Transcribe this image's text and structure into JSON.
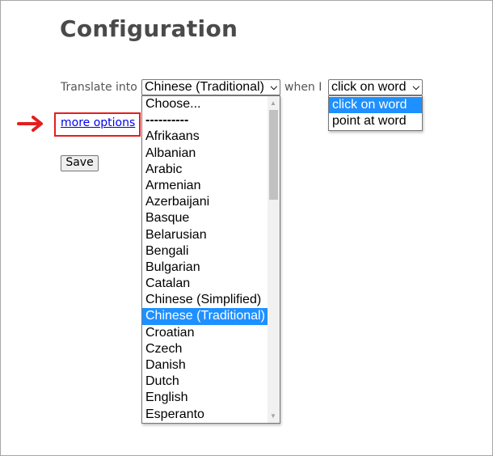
{
  "page": {
    "title": "Configuration",
    "translate_label": "Translate into",
    "when_label": "when I",
    "more_options_link": "more options",
    "save_button": "Save"
  },
  "language_select": {
    "selected": "Chinese (Traditional)",
    "options": [
      {
        "label": "Choose...",
        "selected": false
      },
      {
        "label": "----------",
        "selected": false
      },
      {
        "label": "Afrikaans",
        "selected": false
      },
      {
        "label": "Albanian",
        "selected": false
      },
      {
        "label": "Arabic",
        "selected": false
      },
      {
        "label": "Armenian",
        "selected": false
      },
      {
        "label": "Azerbaijani",
        "selected": false
      },
      {
        "label": "Basque",
        "selected": false
      },
      {
        "label": "Belarusian",
        "selected": false
      },
      {
        "label": "Bengali",
        "selected": false
      },
      {
        "label": "Bulgarian",
        "selected": false
      },
      {
        "label": "Catalan",
        "selected": false
      },
      {
        "label": "Chinese (Simplified)",
        "selected": false
      },
      {
        "label": "Chinese (Traditional)",
        "selected": true
      },
      {
        "label": "Croatian",
        "selected": false
      },
      {
        "label": "Czech",
        "selected": false
      },
      {
        "label": "Danish",
        "selected": false
      },
      {
        "label": "Dutch",
        "selected": false
      },
      {
        "label": "English",
        "selected": false
      },
      {
        "label": "Esperanto",
        "selected": false
      }
    ]
  },
  "trigger_select": {
    "selected": "click on word",
    "options": [
      {
        "label": "click on word",
        "selected": true
      },
      {
        "label": "point at word",
        "selected": false
      }
    ]
  },
  "colors": {
    "selection": "#1e90ff",
    "annotation": "#e41e1e",
    "link": "#0000ee"
  }
}
